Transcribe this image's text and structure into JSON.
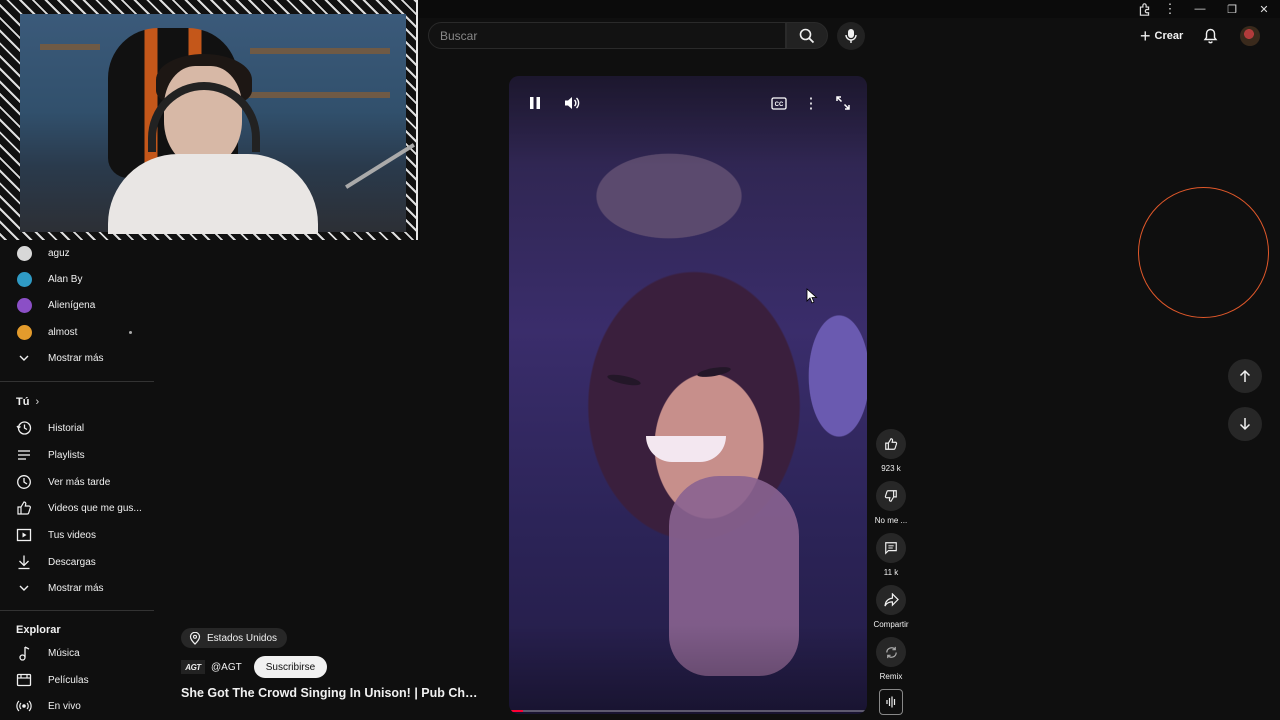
{
  "header": {
    "search_placeholder": "Buscar",
    "create_label": "Crear"
  },
  "sidebar": {
    "subscriptions": [
      {
        "label": "aguz",
        "avatar_color": "#d8d8d8",
        "has_dot": false
      },
      {
        "label": "Alan By",
        "avatar_color": "#2f9ac4",
        "has_dot": false
      },
      {
        "label": "Alienígena",
        "avatar_color": "#8b4fc6",
        "has_dot": false
      },
      {
        "label": "almost",
        "avatar_color": "#e39b2c",
        "has_dot": true
      }
    ],
    "subs_show_more": "Mostrar más",
    "you_heading": "Tú",
    "you_items": [
      {
        "label": "Historial",
        "icon": "history-icon"
      },
      {
        "label": "Playlists",
        "icon": "playlists-icon"
      },
      {
        "label": "Ver más tarde",
        "icon": "watch-later-icon"
      },
      {
        "label": "Videos que me gus...",
        "icon": "liked-videos-icon"
      },
      {
        "label": "Tus videos",
        "icon": "your-videos-icon"
      },
      {
        "label": "Descargas",
        "icon": "downloads-icon"
      }
    ],
    "you_show_more": "Mostrar más",
    "explore_heading": "Explorar",
    "explore_items": [
      {
        "label": "Música",
        "icon": "music-icon"
      },
      {
        "label": "Películas",
        "icon": "movies-icon"
      },
      {
        "label": "En vivo",
        "icon": "live-icon"
      }
    ]
  },
  "video": {
    "location": "Estados Unidos",
    "channel_logo_text": "AGT",
    "channel_handle": "@AGT",
    "subscribe_label": "Suscribirse",
    "title": "She Got The Crowd Singing In Unison! | Pub Cho...",
    "progress_fraction": 0.04
  },
  "actions": {
    "like_count": "923 k",
    "dislike_label": "No me ...",
    "comments_count": "11 k",
    "share_label": "Compartir",
    "remix_label": "Remix"
  },
  "colors": {
    "background": "#0f0f0f",
    "accent_red": "#ff0033",
    "overlay_ring": "#e0582a"
  }
}
